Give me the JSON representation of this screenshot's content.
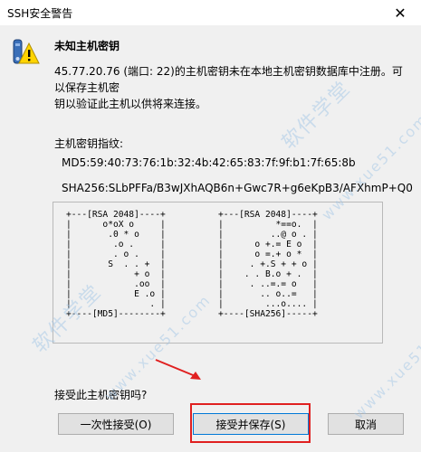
{
  "window": {
    "title": "SSH安全警告",
    "close_glyph": "✕"
  },
  "header": {
    "title": "未知主机密钥"
  },
  "description": {
    "line1": "45.77.20.76 (端口: 22)的主机密钥未在本地主机密钥数据库中注册。可以保存主机密",
    "line2": "钥以验证此主机以供将来连接。"
  },
  "fingerprint": {
    "label": "主机密钥指纹:",
    "md5": "MD5:59:40:73:76:1b:32:4b:42:65:83:7f:9f:b1:7f:65:8b",
    "sha256": "SHA256:SLbPFFa/B3wJXhAQB6n+Gwc7R+g6eKpB3/AFXhmP+Q0"
  },
  "randomart": {
    "left": "+---[RSA 2048]----+\n|      o*oX o     |\n|       .0 * o    |\n|        .o .     |\n|        . o .    |\n|       S  . . +  |\n|            + o  |\n|            .oo  |\n|            E .o |\n|               . |\n+----[MD5]--------+",
    "right": "+---[RSA 2048]----+\n|          *==o.  |\n|         ..@ o . |\n|      o +.= E o  |\n|      o =.+ o *  |\n|     . +.S + + o |\n|    . . B.o + .  |\n|     . ..=.= o   |\n|       .. o..=   |\n|        ...o.... |\n+----[SHA256]-----+"
  },
  "question": "接受此主机密钥吗?",
  "buttons": {
    "accept_once": "一次性接受(O)",
    "accept_save": "接受并保存(S)",
    "cancel": "取消"
  },
  "watermark": {
    "text_cn": "软件学堂",
    "text_url": "www.xue51.com"
  },
  "colors": {
    "dialog_bg": "#f0f0f0",
    "button_bg": "#e1e1e1",
    "focus_border": "#0078d7",
    "highlight": "#e02020"
  }
}
